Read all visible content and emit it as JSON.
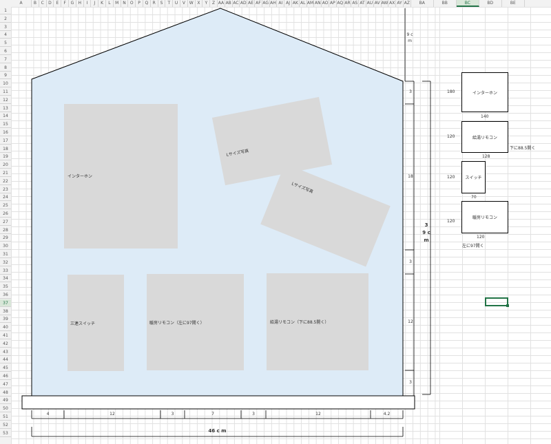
{
  "spreadsheet": {
    "columns": [
      "A",
      "B",
      "C",
      "D",
      "E",
      "F",
      "G",
      "H",
      "I",
      "J",
      "K",
      "L",
      "M",
      "N",
      "O",
      "P",
      "Q",
      "R",
      "S",
      "T",
      "U",
      "V",
      "W",
      "X",
      "Y",
      "Z",
      "AA",
      "AB",
      "AC",
      "AD",
      "AE",
      "AF",
      "AG",
      "AH",
      "AI",
      "AJ",
      "AK",
      "AL",
      "AM",
      "AN",
      "AO",
      "AP",
      "AQ",
      "AR",
      "AS",
      "AT",
      "AU",
      "AV",
      "AW",
      "AX",
      "AY",
      "AZ",
      "BA",
      "BB",
      "BC",
      "BD",
      "BE"
    ],
    "rows": [
      "1",
      "2",
      "3",
      "4",
      "5",
      "6",
      "7",
      "8",
      "9",
      "10",
      "11",
      "12",
      "13",
      "14",
      "15",
      "16",
      "17",
      "18",
      "19",
      "20",
      "21",
      "22",
      "23",
      "24",
      "25",
      "26",
      "27",
      "28",
      "29",
      "30",
      "31",
      "32",
      "33",
      "34",
      "35",
      "36",
      "37",
      "38",
      "39",
      "40",
      "41",
      "42",
      "43",
      "44",
      "45",
      "46",
      "47",
      "48",
      "49",
      "50",
      "51",
      "52",
      "53"
    ],
    "selected_column": "BC",
    "selected_row": "37"
  },
  "house": {
    "items": [
      {
        "id": "intercom",
        "label": "インターホン"
      },
      {
        "id": "photo1",
        "label": "Lサイズ写真"
      },
      {
        "id": "photo2",
        "label": "Lサイズ写真"
      },
      {
        "id": "switch3",
        "label": "三連スイッチ"
      },
      {
        "id": "heater-remote",
        "label": "暖房リモコン（左に97開く）"
      },
      {
        "id": "water-remote",
        "label": "給湯リモコン（下に88.5開く）"
      }
    ],
    "right_dims": {
      "top_height": "9 c m",
      "seg_top": "3",
      "seg_mid": "18",
      "seg_mid2": "3",
      "seg_low": "12",
      "seg_bottom": "3",
      "total": "3 9 c m"
    },
    "bottom_dims": {
      "segments": [
        "4",
        "12",
        "3",
        "7",
        "3",
        "12",
        "4.2"
      ],
      "total": "46 c m"
    }
  },
  "legend": {
    "items": [
      {
        "height": "180",
        "label": "インターホン",
        "width": "140",
        "note": ""
      },
      {
        "height": "120",
        "label": "給湯リモコン",
        "width": "128",
        "note": "下に88.5開く"
      },
      {
        "height": "120",
        "label": "スイッチ",
        "width": "70",
        "note": ""
      },
      {
        "height": "120",
        "label": "暖房リモコン",
        "width": "120",
        "note": "左に97開く"
      }
    ]
  }
}
